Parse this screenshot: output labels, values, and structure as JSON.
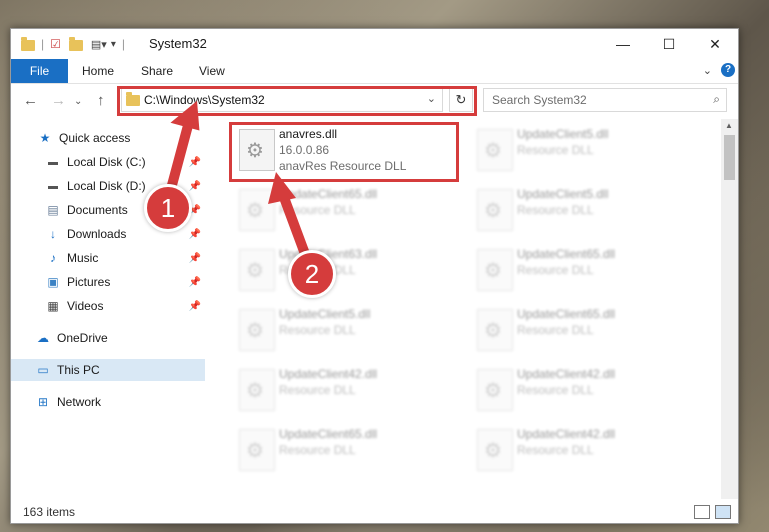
{
  "window": {
    "title": "System32"
  },
  "ribbon": {
    "file": "File",
    "home": "Home",
    "share": "Share",
    "view": "View",
    "help": "?"
  },
  "navigation": {
    "address": "C:\\Windows\\System32",
    "search_placeholder": "Search System32"
  },
  "sidebar": {
    "items": [
      {
        "label": "Quick access",
        "icon": "star-icon"
      },
      {
        "label": "Local Disk (C:)",
        "icon": "drive-icon",
        "pinned": true
      },
      {
        "label": "Local Disk (D:)",
        "icon": "drive-icon",
        "pinned": true
      },
      {
        "label": "Documents",
        "icon": "documents-icon",
        "pinned": true
      },
      {
        "label": "Downloads",
        "icon": "download-icon",
        "pinned": true
      },
      {
        "label": "Music",
        "icon": "music-icon",
        "pinned": true
      },
      {
        "label": "Pictures",
        "icon": "pictures-icon",
        "pinned": true
      },
      {
        "label": "Videos",
        "icon": "videos-icon",
        "pinned": true
      },
      {
        "label": "OneDrive",
        "icon": "cloud-icon"
      },
      {
        "label": "This PC",
        "icon": "computer-icon",
        "selected": true
      },
      {
        "label": "Network",
        "icon": "network-icon"
      }
    ]
  },
  "files": {
    "highlighted": {
      "name": "anavres.dll",
      "version": "16.0.0.86",
      "description": "anavRes Resource DLL"
    },
    "left_column": [
      {
        "name": "UpdateClient65.dll",
        "description": "Resource DLL"
      },
      {
        "name": "UpdateClient63.dll",
        "description": "Resource DLL"
      },
      {
        "name": "UpdateClient5.dll",
        "description": "Resource DLL"
      },
      {
        "name": "UpdateClient42.dll",
        "description": "Resource DLL"
      },
      {
        "name": "UpdateClient65.dll",
        "description": "Resource DLL"
      }
    ],
    "right_column": [
      {
        "name": "UpdateClient5.dll",
        "description": "Resource DLL"
      },
      {
        "name": "UpdateClient5.dll",
        "description": "Resource DLL"
      },
      {
        "name": "UpdateClient65.dll",
        "description": "Resource DLL"
      },
      {
        "name": "UpdateClient65.dll",
        "description": "Resource DLL"
      },
      {
        "name": "UpdateClient42.dll",
        "description": "Resource DLL"
      },
      {
        "name": "UpdateClient42.dll",
        "description": "Resource DLL"
      }
    ]
  },
  "status": {
    "item_count": "163 items"
  },
  "callouts": {
    "step1": "1",
    "step2": "2"
  },
  "colors": {
    "accent": "#1a6fc4",
    "callout": "#d53c3c"
  }
}
